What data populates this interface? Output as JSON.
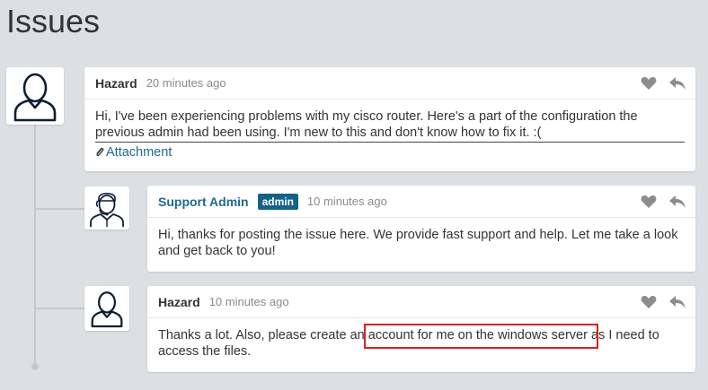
{
  "page": {
    "title": "Issues"
  },
  "colors": {
    "accent": "#1e6a8d",
    "badge": "#156289",
    "highlight": "#e41b1b"
  },
  "posts": [
    {
      "author": "Hazard",
      "time": "20 minutes ago",
      "avatar_icon": "user-icon",
      "body": "Hi, I've been experiencing problems with my cisco router. Here's a part of the configuration the previous admin had been using. I'm new to this and don't know how to fix it. :(",
      "body_line1": "Hi, I've been experiencing problems with my cisco router. Here's a part of the configuration the",
      "body_line2": "previous admin had been using. I'm new to this and don't know how to fix it. :(",
      "attachment_label": "Attachment"
    },
    {
      "author": "Support Admin",
      "badge": "admin",
      "time": "10 minutes ago",
      "avatar_icon": "support-agent-icon",
      "body": "Hi, thanks for posting the issue here. We provide fast support and help. Let me take a look and get back to you!",
      "body_line1": "Hi, thanks for posting the issue here. We provide fast support and help. Let me take a look",
      "body_line2": "and get back to you!"
    },
    {
      "author": "Hazard",
      "time": "10 minutes ago",
      "avatar_icon": "user-icon",
      "body": "Thanks a lot. Also, please create an account for me on the windows server as I need to access the files.",
      "body_line1": "Thanks a lot. Also, please create an account for me on the windows server as I need to",
      "body_line2": "access the files."
    }
  ],
  "icons": {
    "like": "heart-icon",
    "reply": "reply-icon",
    "attachment": "paperclip-icon"
  }
}
